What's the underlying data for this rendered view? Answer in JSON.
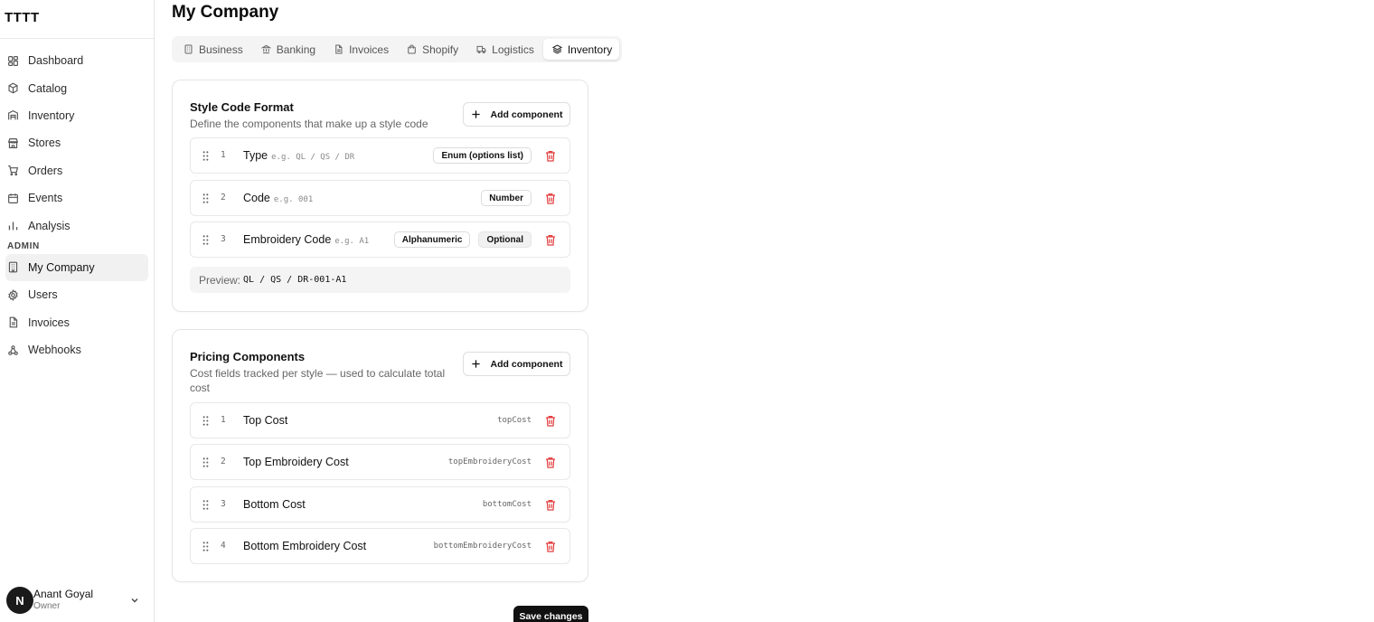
{
  "sidebar": {
    "brand": "TTTT",
    "items": [
      {
        "label": "Dashboard",
        "icon": "grid-icon"
      },
      {
        "label": "Catalog",
        "icon": "box-icon"
      },
      {
        "label": "Inventory",
        "icon": "warehouse-icon"
      },
      {
        "label": "Stores",
        "icon": "store-icon"
      },
      {
        "label": "Orders",
        "icon": "cart-icon"
      },
      {
        "label": "Events",
        "icon": "calendar-icon"
      },
      {
        "label": "Analysis",
        "icon": "bar-chart-icon"
      }
    ],
    "section_label": "ADMIN",
    "admin_items": [
      {
        "label": "My Company",
        "icon": "building-icon",
        "active": true
      },
      {
        "label": "Users",
        "icon": "gear-icon"
      },
      {
        "label": "Invoices",
        "icon": "file-icon"
      },
      {
        "label": "Webhooks",
        "icon": "webhook-icon"
      }
    ],
    "user": {
      "initial": "N",
      "name": "Anant Goyal",
      "role": "Owner"
    }
  },
  "header": {
    "title": "My Company"
  },
  "tabs": [
    {
      "label": "Business",
      "icon": "building-icon"
    },
    {
      "label": "Banking",
      "icon": "bank-icon"
    },
    {
      "label": "Invoices",
      "icon": "file-icon"
    },
    {
      "label": "Shopify",
      "icon": "shopping-bag-icon"
    },
    {
      "label": "Logistics",
      "icon": "truck-icon"
    },
    {
      "label": "Inventory",
      "icon": "layers-icon",
      "active": true
    }
  ],
  "style_code": {
    "title": "Style Code Format",
    "description": "Define the components that make up a style code",
    "add_label": "Add component",
    "components": [
      {
        "index": "1",
        "name": "Type",
        "example": "e.g. QL / QS / DR",
        "badges": [
          "Enum (options list)"
        ]
      },
      {
        "index": "2",
        "name": "Code",
        "example": "e.g. 001",
        "badges": [
          "Number"
        ]
      },
      {
        "index": "3",
        "name": "Embroidery Code",
        "example": "e.g. A1",
        "badges": [
          "Alphanumeric",
          "Optional"
        ]
      }
    ],
    "preview_label": "Preview:",
    "preview_value": "QL / QS / DR-001-A1"
  },
  "pricing": {
    "title": "Pricing Components",
    "description": "Cost fields tracked per style — used to calculate total cost",
    "add_label": "Add component",
    "components": [
      {
        "index": "1",
        "name": "Top Cost",
        "key": "topCost"
      },
      {
        "index": "2",
        "name": "Top Embroidery Cost",
        "key": "topEmbroideryCost"
      },
      {
        "index": "3",
        "name": "Bottom Cost",
        "key": "bottomCost"
      },
      {
        "index": "4",
        "name": "Bottom Embroidery Cost",
        "key": "bottomEmbroideryCost"
      }
    ]
  },
  "save_label": "Save changes",
  "colors": {
    "danger": "#e23d3d",
    "primary": "#111111",
    "active_bg": "#f1f1f1"
  }
}
